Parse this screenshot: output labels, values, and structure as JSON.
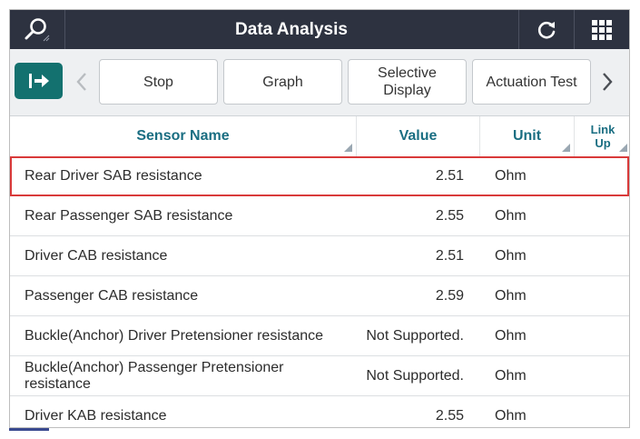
{
  "window": {
    "title": "Data Analysis"
  },
  "titlebar_icons": {
    "search": "search-icon",
    "refresh": "refresh-icon",
    "grid": "grid-menu-icon"
  },
  "toolbar": {
    "exit_icon": "exit-arrow-icon",
    "prev_icon": "chevron-left-icon",
    "next_icon": "chevron-right-icon",
    "stop_label": "Stop",
    "graph_label": "Graph",
    "selective_label_line1": "Selective",
    "selective_label_line2": "Display",
    "actuation_label": "Actuation Test"
  },
  "columns": {
    "name": "Sensor Name",
    "value": "Value",
    "unit": "Unit",
    "link_line1": "Link",
    "link_line2": "Up"
  },
  "rows": [
    {
      "name": "Rear Driver SAB resistance",
      "value": "2.51",
      "unit": "Ohm",
      "selected": true
    },
    {
      "name": "Rear Passenger SAB resistance",
      "value": "2.55",
      "unit": "Ohm",
      "selected": false
    },
    {
      "name": "Driver CAB resistance",
      "value": "2.51",
      "unit": "Ohm",
      "selected": false
    },
    {
      "name": "Passenger CAB resistance",
      "value": "2.59",
      "unit": "Ohm",
      "selected": false
    },
    {
      "name": "Buckle(Anchor) Driver Pretensioner resistance",
      "value": "Not Supported.",
      "unit": "Ohm",
      "selected": false
    },
    {
      "name": "Buckle(Anchor) Passenger Pretensioner resistance",
      "value": "Not Supported.",
      "unit": "Ohm",
      "selected": false
    },
    {
      "name": "Driver KAB resistance",
      "value": "2.55",
      "unit": "Ohm",
      "selected": false
    }
  ],
  "colors": {
    "titlebar_bg": "#2d3240",
    "accent_teal": "#13716f",
    "header_text": "#1a6e82",
    "selection_outline": "#d93a3a"
  }
}
